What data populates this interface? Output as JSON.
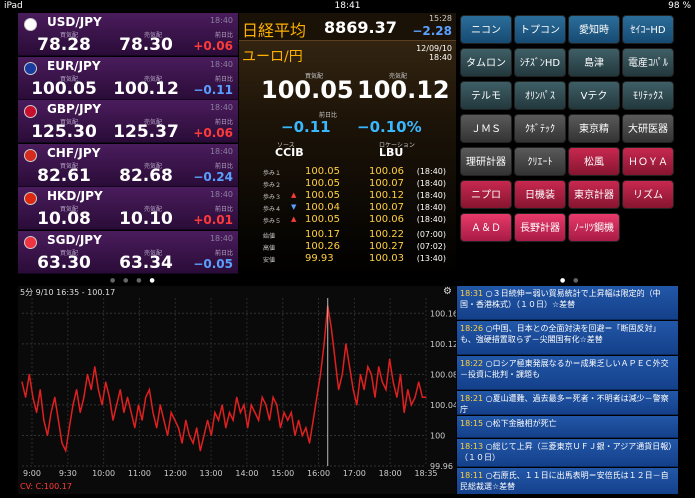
{
  "status": {
    "device": "iPad",
    "time": "18:41",
    "battery": "98 %"
  },
  "fx": [
    {
      "pair": "USD/JPY",
      "time": "18:40",
      "bid": "78.28",
      "ask": "78.30",
      "chg": "+0.06",
      "dir": "up",
      "flag": "japan-flag-icon"
    },
    {
      "pair": "EUR/JPY",
      "time": "18:40",
      "bid": "100.05",
      "ask": "100.12",
      "chg": "−0.11",
      "dir": "dn",
      "flag": "eu-flag-icon"
    },
    {
      "pair": "GBP/JPY",
      "time": "18:40",
      "bid": "125.30",
      "ask": "125.37",
      "chg": "+0.06",
      "dir": "up",
      "flag": "uk-flag-icon"
    },
    {
      "pair": "CHF/JPY",
      "time": "18:40",
      "bid": "82.61",
      "ask": "82.68",
      "chg": "−0.24",
      "dir": "dn",
      "flag": "swiss-flag-icon"
    },
    {
      "pair": "HKD/JPY",
      "time": "18:40",
      "bid": "10.08",
      "ask": "10.10",
      "chg": "+0.01",
      "dir": "up",
      "flag": "hk-flag-icon"
    },
    {
      "pair": "SGD/JPY",
      "time": "18:40",
      "bid": "63.30",
      "ask": "63.34",
      "chg": "−0.05",
      "dir": "dn",
      "flag": "sg-flag-icon"
    }
  ],
  "fx_labels": {
    "bid": "買気配",
    "ask": "売気配",
    "chg": "前日比"
  },
  "nikkei": {
    "label": "日経平均",
    "price": "8869.37",
    "time": "15:28",
    "chg": "−2.28"
  },
  "detail": {
    "title": "ユーロ/円",
    "date": "12/09/10",
    "time": "18:40",
    "bid_label": "買気配",
    "ask_label": "売気配",
    "bid": "100.05",
    "ask": "100.12",
    "chg_label": "前日比",
    "chg": "−0.11",
    "pct": "−0.10%",
    "source_label": "ソース",
    "location_label": "ロケーション",
    "source": "CCIB",
    "location": "LBU",
    "quotes": [
      {
        "label": "歩み１",
        "mark": "",
        "bid": "100.05",
        "ask": "100.06",
        "time": "(18:40)"
      },
      {
        "label": "歩み２",
        "mark": "",
        "bid": "100.05",
        "ask": "100.07",
        "time": "(18:40)"
      },
      {
        "label": "歩み３",
        "mark": "▲",
        "bid": "100.05",
        "ask": "100.12",
        "time": "(18:40)"
      },
      {
        "label": "歩み４",
        "mark": "▼",
        "bid": "100.04",
        "ask": "100.07",
        "time": "(18:40)"
      },
      {
        "label": "歩み５",
        "mark": "▲",
        "bid": "100.05",
        "ask": "100.06",
        "time": "(18:40)"
      }
    ],
    "ohl": [
      {
        "label": "始値",
        "bid": "100.17",
        "ask": "100.22",
        "time": "(07:00)"
      },
      {
        "label": "高値",
        "bid": "100.26",
        "ask": "100.27",
        "time": "(07:02)"
      },
      {
        "label": "安値",
        "bid": "99.93",
        "ask": "100.03",
        "time": "(13:40)"
      }
    ]
  },
  "stocks": [
    {
      "name": "ニコン",
      "style": "c-blue"
    },
    {
      "name": "トプコン",
      "style": "c-blue"
    },
    {
      "name": "愛知時",
      "style": "c-blue"
    },
    {
      "name": "ｾｲｺｰHD",
      "style": "c-blue"
    },
    {
      "name": "タムロン",
      "style": "c-teal"
    },
    {
      "name": "ｼﾁｽﾞﾝHD",
      "style": "c-teal"
    },
    {
      "name": "島津",
      "style": "c-teal"
    },
    {
      "name": "電産ｺﾊﾟﾙ",
      "style": "c-teal"
    },
    {
      "name": "テルモ",
      "style": "c-teal"
    },
    {
      "name": "ｵﾘﾝﾊﾟｽ",
      "style": "c-teal"
    },
    {
      "name": "Vテク",
      "style": "c-teal"
    },
    {
      "name": "ﾓﾘﾃｯｸｽ",
      "style": "c-teal"
    },
    {
      "name": "ＪＭＳ",
      "style": "c-gray"
    },
    {
      "name": "ｸﾎﾞﾃｯｸ",
      "style": "c-gray"
    },
    {
      "name": "東京精",
      "style": "c-gray"
    },
    {
      "name": "大研医器",
      "style": "c-gray"
    },
    {
      "name": "理研計器",
      "style": "c-gray"
    },
    {
      "name": "ｸﾘｴｰﾄ",
      "style": "c-gray"
    },
    {
      "name": "松風",
      "style": "c-red"
    },
    {
      "name": "ＨＯＹＡ",
      "style": "c-red"
    },
    {
      "name": "ニプロ",
      "style": "c-red"
    },
    {
      "name": "日機装",
      "style": "c-red"
    },
    {
      "name": "東京計器",
      "style": "c-red"
    },
    {
      "name": "リズム",
      "style": "c-red"
    },
    {
      "name": "Ａ＆Ｄ",
      "style": "c-pink"
    },
    {
      "name": "長野計器",
      "style": "c-pink"
    },
    {
      "name": "ﾉｰﾘﾂ鋼機",
      "style": "c-pink"
    }
  ],
  "chart_data": {
    "type": "line",
    "title": "5分 9/10 16:35 - 100.17",
    "x_ticks": [
      "9:00",
      "9:30",
      "10:00",
      "11:00",
      "12:00",
      "13:00",
      "14:00",
      "15:00",
      "16:00",
      "17:00",
      "18:00",
      "18:35"
    ],
    "y_ticks": [
      "100.16",
      "100.12",
      "100.08",
      "100.04",
      "100",
      "99.96"
    ],
    "ylim": [
      99.96,
      100.18
    ],
    "y": [
      100.07,
      100.05,
      100.08,
      100.05,
      100.03,
      100.06,
      100.02,
      100.0,
      100.03,
      100.05,
      100.02,
      99.99,
      99.98,
      100.01,
      100.04,
      100.06,
      100.03,
      100.05,
      100.08,
      100.06,
      100.09,
      100.06,
      100.04,
      100.07,
      100.05,
      100.02,
      100.04,
      100.06,
      100.03,
      100.05,
      100.03,
      100.01,
      100.04,
      100.02,
      100.05,
      100.06,
      100.03,
      100.01,
      100.04,
      100.02,
      100.0,
      100.03,
      100.02,
      100.01,
      99.99,
      100.02,
      100.0,
      99.99,
      100.01,
      99.98,
      100.0,
      100.02,
      100.0,
      100.03,
      100.02,
      100.04,
      100.01,
      100.03,
      100.02,
      100.05,
      100.03,
      100.04,
      100.01,
      100.04,
      100.03,
      100.02,
      100.05,
      100.04,
      100.02,
      100.05,
      100.04,
      100.01,
      100.03,
      100.02,
      100.03,
      100.0,
      100.02,
      100.0,
      100.01,
      99.99,
      100.02,
      100.05,
      100.08,
      100.12,
      100.17,
      100.14,
      100.1,
      100.06,
      100.08,
      100.12,
      100.09,
      100.06,
      100.04,
      100.08,
      100.06,
      100.09,
      100.08,
      100.05,
      100.09,
      100.07,
      100.06,
      100.1,
      100.07,
      100.05,
      100.08,
      100.03,
      100.06,
      100.04,
      100.05,
      100.07,
      100.05,
      100.05
    ],
    "cursor_index": 84,
    "cv_label": "CV: C:100.17"
  },
  "news": [
    {
      "time": "18:31",
      "text": "○３日続伸＝弱い貿易統計で上昇幅は限定的（中国・香港株式）（１０日）☆差替"
    },
    {
      "time": "18:26",
      "text": "○中国、日本との全面対決を回避＝「断固反対」も、強硬措置取らず－尖閣国有化☆差替"
    },
    {
      "time": "18:22",
      "text": "○ロシア極東発展なるか＝成果乏しいＡＰＥＣ外交－投資に批判・課題も"
    },
    {
      "time": "18:21",
      "text": "○夏山遭難、過去最多＝死者・不明者は減少－警察庁"
    },
    {
      "time": "18:15",
      "text": "○松下金融相が死亡"
    },
    {
      "time": "18:13",
      "text": "○総じて上昇（三菱東京ＵＦＪ銀・アジア通貨日報）（１０日）"
    },
    {
      "time": "18:11",
      "text": "○石原氏、１１日に出馬表明＝安倍氏は１２日－自民総裁選☆差替"
    }
  ],
  "colors": {
    "up": "#ff3a3a",
    "down": "#5aa0ff",
    "line": "#e02020"
  }
}
